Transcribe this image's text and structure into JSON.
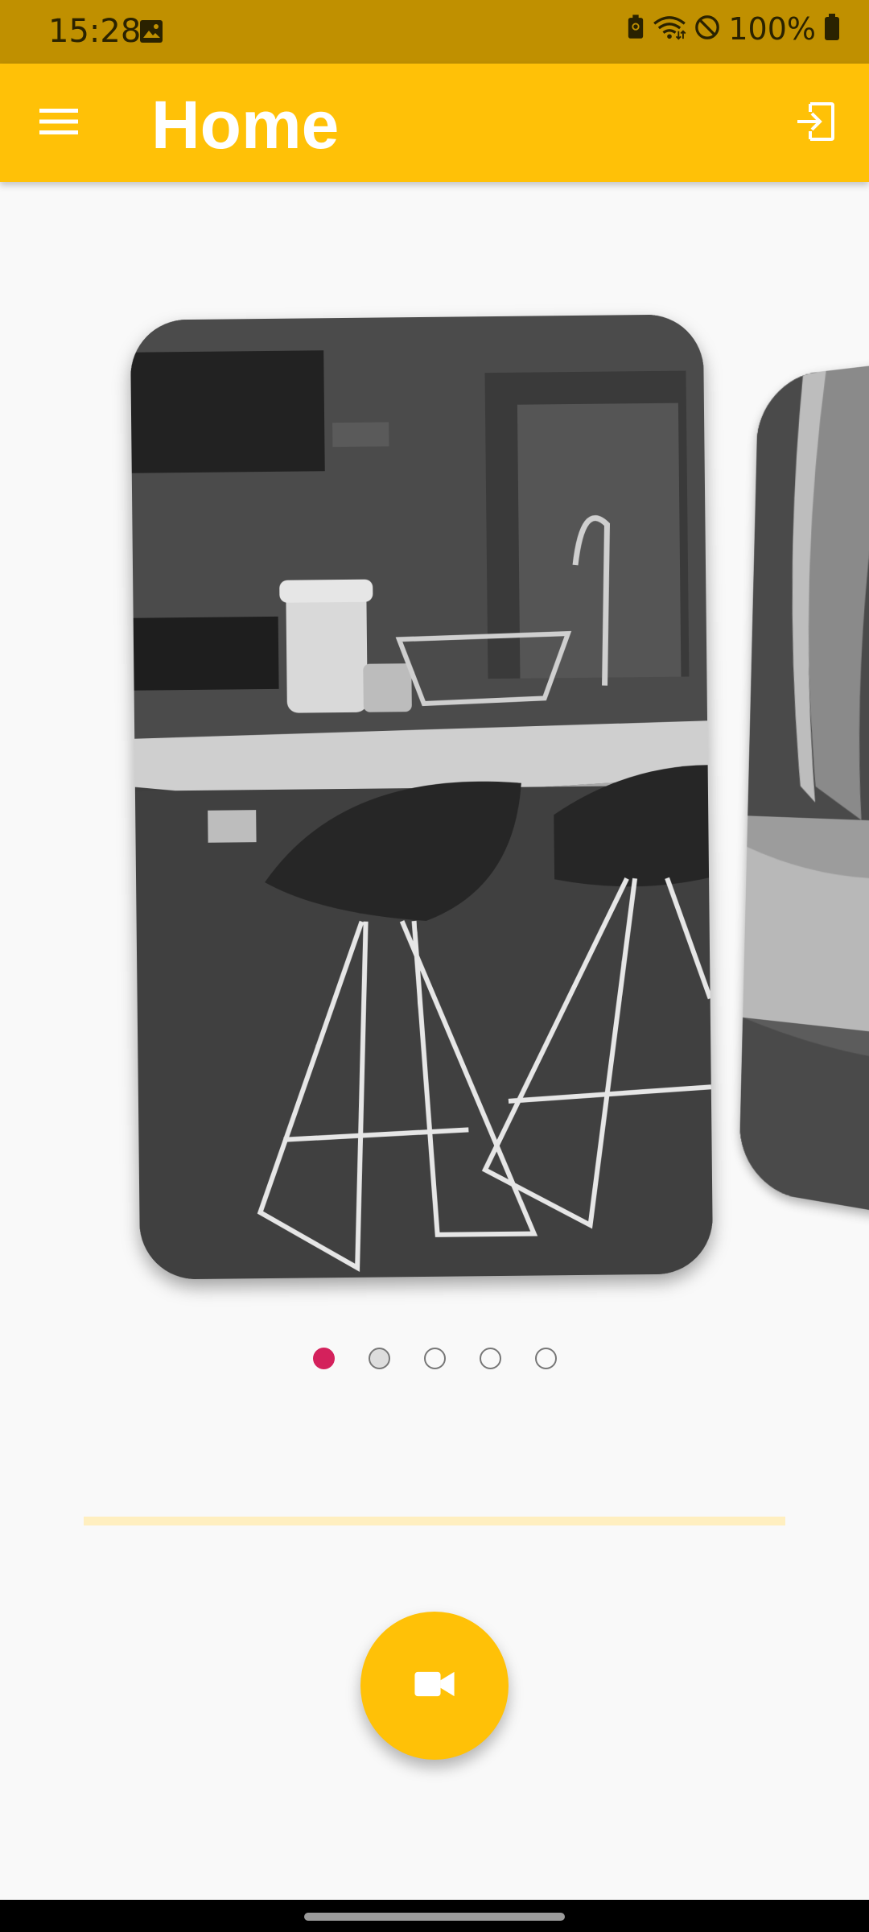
{
  "status_bar": {
    "time": "15:28",
    "battery": "100%",
    "icons": [
      "image-icon",
      "battery-saver-icon",
      "wifi-icon",
      "do-not-disturb-icon",
      "battery-icon"
    ]
  },
  "app_bar": {
    "title": "Home",
    "menu_icon": "menu-icon",
    "action_icon": "logout-icon"
  },
  "carousel": {
    "cameras": [
      {
        "feed": "kitchen-camera-feed",
        "active": true
      },
      {
        "feed": "yard-camera-feed",
        "active": false
      }
    ],
    "page_count": 5,
    "current_page": 1
  },
  "fab": {
    "icon": "videocam-icon"
  },
  "colors": {
    "status_bar": "#c09000",
    "app_bar": "#ffc107",
    "active_dot": "#d4215c",
    "divider": "#ffefc0",
    "background": "#f9f9f9"
  }
}
